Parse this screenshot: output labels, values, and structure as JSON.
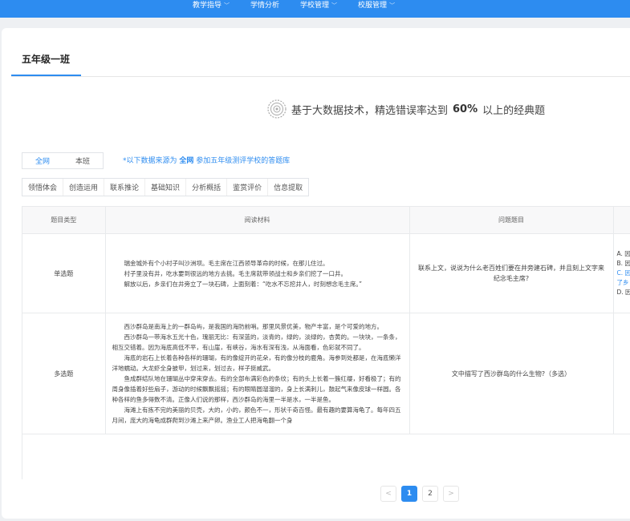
{
  "topnav": [
    {
      "label": "教学指导",
      "chevron": true
    },
    {
      "label": "学情分析",
      "chevron": false
    },
    {
      "label": "学校管理",
      "chevron": true
    },
    {
      "label": "校服管理",
      "chevron": true
    }
  ],
  "class_tab": "五年级一班",
  "banner": {
    "prefix": "基于大数据技术，精选错误率达到",
    "highlight": "60%",
    "suffix": "以上的经典题"
  },
  "scope": {
    "options": [
      "全网",
      "本班"
    ],
    "active": "全网"
  },
  "note": {
    "prefix": "*以下数据来源为",
    "highlight": "全网",
    "suffix": "参加五年级测评学校的答题库"
  },
  "categories": [
    "领悟体会",
    "创造运用",
    "联系推论",
    "基础知识",
    "分析概括",
    "鉴赏评价",
    "信息提取"
  ],
  "table": {
    "headers": [
      "题目类型",
      "阅读材料",
      "问题题目",
      ""
    ],
    "rows": [
      {
        "type": "单选题",
        "material": [
          "瑞金城外有个小村子叫沙洲坝。毛主席在江西领导革命的时候，在那儿住过。",
          "村子里没有井，吃水要到很远的地方去挑。毛主席就带领战士和乡亲们挖了一口井。",
          "解放以后，乡亲们在井旁立了一块石碑，上面刻着：“吃水不忘挖井人，时刻想念毛主席。”"
        ],
        "question": "联系上文，说说为什么老百姓们要在井旁建石碑，并且刻上文字来纪念毛主席?",
        "options": [
          "A. 因",
          "B. 因",
          "C. 因",
          "了乡",
          "D. 因"
        ],
        "selected_index": 2
      },
      {
        "type": "多选题",
        "material": [
          "西沙群岛是南海上的一群岛屿，是我国的海防前哨。那里风景优美，物产丰富，是个可爱的地方。",
          "西沙群岛一带海水五光十色，瑰丽无比：有深蓝的，淡青的，绿的，淡绿的，杏黄的。一块块，一条条，相互交错着。因为海底高低不平，有山崖，有峡谷，海水有深有浅，从海面看，色彩就不同了。",
          "海底的岩石上长着各种各样的珊瑚，有的像绽开的花朵，有的像分枝的鹿角。海参到处都是，在海底懒洋洋地蠕动。大龙虾全身披甲，划过来，划过去，样子挺威武。",
          "鱼成群结队地在珊瑚丛中穿来穿去。有的全部布满彩色的条纹；有的头上长着一簇红缨，好看极了；有的周身像插着好些扇子，游动的时候飘飘摇摇；有的眼睛圆溜溜的，身上长满刺儿，鼓起气来像皮球一样圆。各种各样的鱼多得数不清。正像人们说的那样，西沙群岛的海里一半是水，一半是鱼。",
          "海滩上有拣不完的美丽的贝壳，大的，小的，颜色不一，形状千奇百怪。最有趣的要算海龟了。每年四五月间，庞大的海龟成群爬到沙滩上来产卵。渔业工人把海龟翻一个身"
        ],
        "question": "文中描写了西沙群岛的什么生物?（多选）",
        "options": [],
        "selected_index": -1
      }
    ]
  },
  "pagination": {
    "prev": "<",
    "pages": [
      "1",
      "2"
    ],
    "current": "1",
    "next": ">"
  },
  "colors": {
    "accent": "#2d8cf0",
    "background": "#eef0f3"
  },
  "icons": {
    "banner": "target-icon",
    "chevron": "chevron-down-icon"
  }
}
